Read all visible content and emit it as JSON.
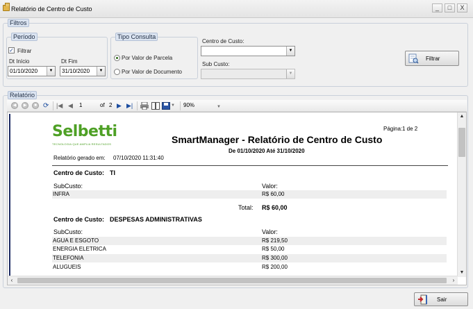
{
  "window": {
    "title": "Relatório de Centro de Custo",
    "icon": "folder-icon",
    "controls": [
      "_",
      "□",
      "X"
    ]
  },
  "filtros": {
    "legend": "Filtros",
    "periodo": {
      "legend": "Período",
      "filtrar_label": "Filtrar",
      "filtrar_checked": true,
      "dt_inicio_label": "Dt Início",
      "dt_inicio_value": "01/10/2020",
      "dt_fim_label": "Dt Fim",
      "dt_fim_value": "31/10/2020"
    },
    "tipo_consulta": {
      "legend": "Tipo Consulta",
      "options": [
        {
          "label": "Por Valor de Parcela",
          "selected": true
        },
        {
          "label": "Por Valor de Documento",
          "selected": false
        }
      ]
    },
    "centro_custo_label": "Centro de Custo:",
    "centro_custo_value": "",
    "sub_custo_label": "Sub Custo:",
    "sub_custo_value": "",
    "filtrar_button": "Filtrar"
  },
  "relatorio": {
    "legend": "Relatório",
    "toolbar": {
      "current_page": "1",
      "of_label": "of",
      "total_pages": "2",
      "zoom": "90%"
    },
    "report": {
      "logo_text": "Selbetti",
      "logo_tagline": "TECNOLOGIA QUE AMPLIA RESULTADOS",
      "page_label": "Página:",
      "page_value": "1 de 2",
      "title": "SmartManager - Relatório de Centro de Custo",
      "period": "De 01/10/2020 Até 31/10/2020",
      "generated_label": "Relatório gerado em:",
      "generated_value": "07/10/2020 11:31:40",
      "sections": [
        {
          "cc_label": "Centro de Custo:",
          "cc_value": "TI",
          "sub_header": "SubCusto:",
          "val_header": "Valor:",
          "rows": [
            {
              "name": "INFRA",
              "value": "R$ 60,00"
            }
          ],
          "total_label": "Total:",
          "total_value": "R$ 60,00"
        },
        {
          "cc_label": "Centro de Custo:",
          "cc_value": "DESPESAS ADMINISTRATIVAS",
          "sub_header": "SubCusto:",
          "val_header": "Valor:",
          "rows": [
            {
              "name": "AGUA E ESGOTO",
              "value": "R$ 219,50"
            },
            {
              "name": "ENERGIA ELETRICA",
              "value": "R$ 50,00"
            },
            {
              "name": "TELEFONIA",
              "value": "R$ 300,00"
            },
            {
              "name": "ALUGUEIS",
              "value": "R$ 200,00"
            }
          ]
        }
      ]
    }
  },
  "footer": {
    "sair_button": "Sair"
  }
}
